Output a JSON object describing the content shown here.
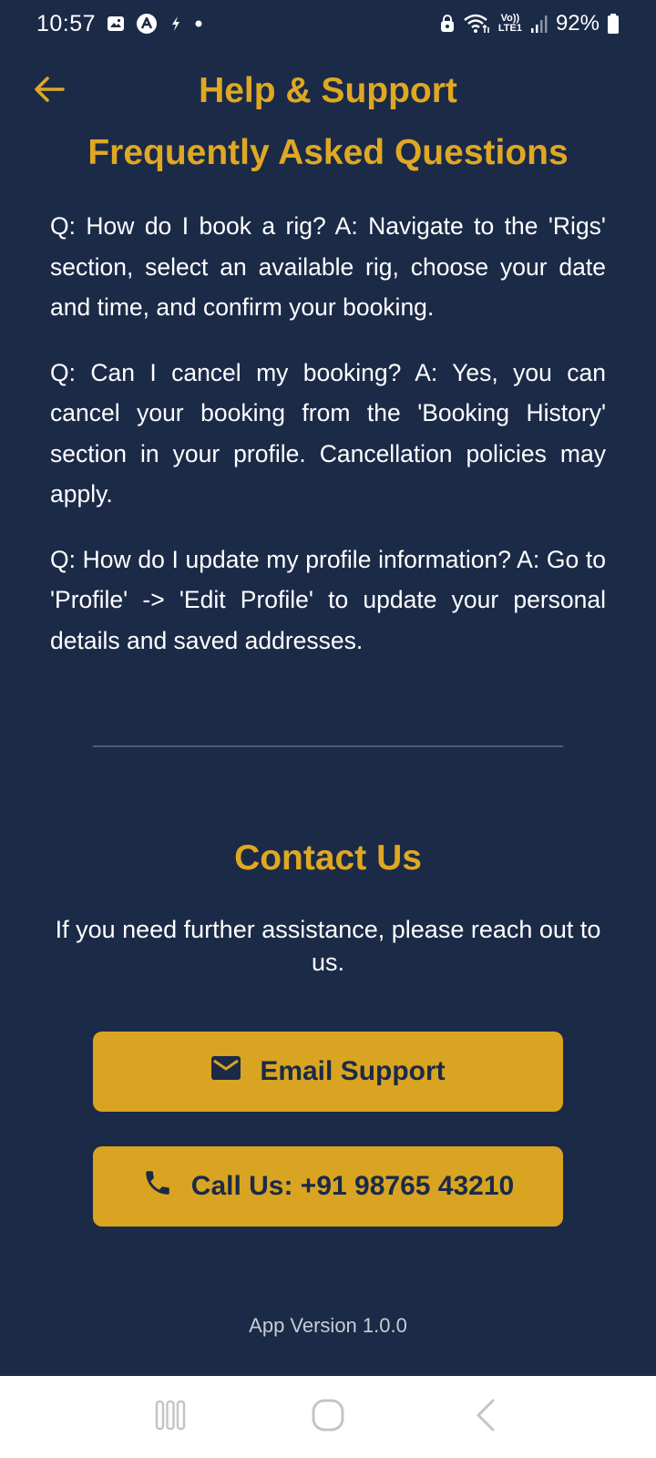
{
  "status_bar": {
    "time": "10:57",
    "battery": "92%",
    "network_label": "Vo)) LTE1",
    "icons": [
      "gallery-icon",
      "app-a-icon",
      "flash-icon",
      "dot-icon",
      "lock-icon",
      "wifi-icon",
      "volte-icon",
      "signal-icon",
      "battery-icon"
    ]
  },
  "header": {
    "title": "Help & Support",
    "back_icon": "back-arrow-icon"
  },
  "faq": {
    "heading": "Frequently Asked Questions",
    "items": [
      "Q: How do I book a rig? A: Navigate to the 'Rigs' section, select an available rig, choose your date and time, and confirm your booking.",
      "Q: Can I cancel my booking? A: Yes, you can cancel your booking from the 'Booking History' section in your profile. Cancellation policies may apply.",
      "Q: How do I update my profile information? A: Go to 'Profile' -> 'Edit Profile' to update your personal details and saved addresses."
    ]
  },
  "contact": {
    "heading": "Contact Us",
    "text": "If you need further assistance, please reach out to us.",
    "email_label": "Email Support",
    "call_label": "Call Us: +91 98765 43210"
  },
  "footer": {
    "version": "App Version 1.0.0"
  },
  "colors": {
    "background": "#1b2a47",
    "accent": "#dfa823",
    "button": "#d9a421",
    "text": "#ffffff"
  },
  "nav_bar": {
    "icons": [
      "recent-apps-icon",
      "home-icon",
      "back-icon"
    ]
  }
}
